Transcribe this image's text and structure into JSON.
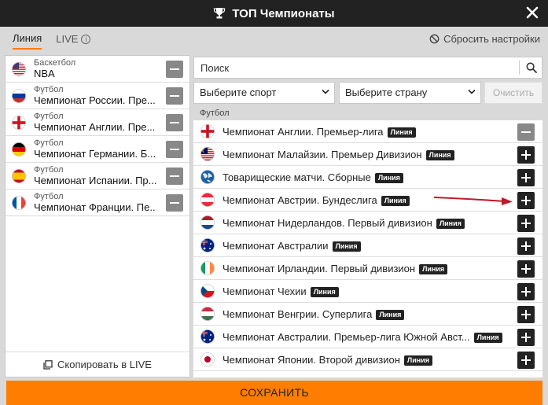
{
  "header": {
    "title": "ТОП Чемпионаты"
  },
  "tabs": [
    {
      "label": "Линия"
    },
    {
      "label": "LIVE"
    }
  ],
  "reset_label": "Сбросить настройки",
  "favorites": [
    {
      "sport": "Баскетбол",
      "name": "NBA",
      "flag": "us"
    },
    {
      "sport": "Футбол",
      "name": "Чемпионат России. Пре...",
      "flag": "ru"
    },
    {
      "sport": "Футбол",
      "name": "Чемпионат Англии. Пре...",
      "flag": "en"
    },
    {
      "sport": "Футбол",
      "name": "Чемпионат Германии. Б...",
      "flag": "de"
    },
    {
      "sport": "Футбол",
      "name": "Чемпионат Испании. Пр...",
      "flag": "es"
    },
    {
      "sport": "Футбол",
      "name": "Чемпионат Франции. Пе...",
      "flag": "fr"
    }
  ],
  "copy_live_label": "Скопировать в LIVE",
  "search": {
    "placeholder": "Поиск"
  },
  "filters": {
    "sport": "Выберите спорт",
    "country": "Выберите страну",
    "clear": "Очистить"
  },
  "section": "Футбол",
  "badge_label": "Линия",
  "leagues": [
    {
      "name": "Чемпионат Англии. Премьер-лига",
      "flag": "en",
      "added": true
    },
    {
      "name": "Чемпионат Малайзии. Премьер Дивизион",
      "flag": "my",
      "added": false
    },
    {
      "name": "Товарищеские матчи. Сборные",
      "flag": "world",
      "added": false
    },
    {
      "name": "Чемпионат Австрии. Бундеслига",
      "flag": "at",
      "added": false
    },
    {
      "name": "Чемпионат Нидерландов. Первый дивизион",
      "flag": "nl",
      "added": false
    },
    {
      "name": "Чемпионат Австралии",
      "flag": "au",
      "added": false
    },
    {
      "name": "Чемпионат Ирландии. Первый дивизион",
      "flag": "ie",
      "added": false
    },
    {
      "name": "Чемпионат Чехии",
      "flag": "cz",
      "added": false
    },
    {
      "name": "Чемпионат Венгрии. Суперлига",
      "flag": "hu",
      "added": false
    },
    {
      "name": "Чемпионат Австралии. Премьер-лига Южной Авст...",
      "flag": "au",
      "added": false
    },
    {
      "name": "Чемпионат Японии. Второй дивизион",
      "flag": "jp",
      "added": false
    }
  ],
  "save_label": "СОХРАНИТЬ",
  "colors": {
    "accent": "#ff7d00",
    "header": "#222222",
    "arrow": "#c0182a"
  }
}
